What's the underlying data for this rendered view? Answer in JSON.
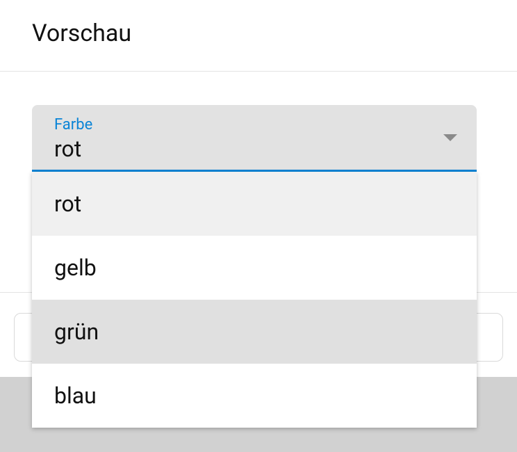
{
  "header": {
    "title": "Vorschau"
  },
  "select": {
    "label": "Farbe",
    "value": "rot",
    "options": [
      "rot",
      "gelb",
      "grün",
      "blau"
    ],
    "selectedIndex": 0,
    "hoverIndex": 2
  }
}
